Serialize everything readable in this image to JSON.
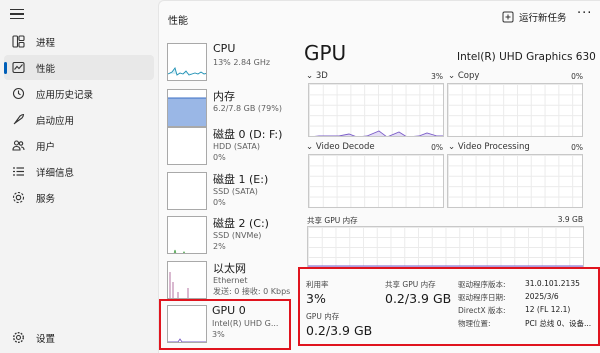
{
  "nav": {
    "items": [
      {
        "label": "进程",
        "icon": "processes-icon"
      },
      {
        "label": "性能",
        "icon": "performance-icon"
      },
      {
        "label": "应用历史记录",
        "icon": "app-history-icon"
      },
      {
        "label": "启动应用",
        "icon": "startup-apps-icon"
      },
      {
        "label": "用户",
        "icon": "users-icon"
      },
      {
        "label": "详细信息",
        "icon": "details-icon"
      },
      {
        "label": "服务",
        "icon": "services-icon"
      }
    ],
    "settings_label": "设置"
  },
  "header": {
    "title": "性能",
    "run_task_label": "运行新任务",
    "more_label": "···"
  },
  "devices": [
    {
      "name": "CPU",
      "sub1": "13%  2.84 GHz",
      "sub2": ""
    },
    {
      "name": "内存",
      "sub1": "6.2/7.8 GB (79%)",
      "sub2": ""
    },
    {
      "name": "磁盘 0 (D: F:)",
      "sub1": "HDD (SATA)",
      "sub2": "0%"
    },
    {
      "name": "磁盘 1 (E:)",
      "sub1": "SSD (SATA)",
      "sub2": "0%"
    },
    {
      "name": "磁盘 2 (C:)",
      "sub1": "SSD (NVMe)",
      "sub2": "2%"
    },
    {
      "name": "以太网",
      "sub1": "Ethernet",
      "sub2": "发送: 0 接收: 0 Kbps"
    },
    {
      "name": "GPU 0",
      "sub1": "Intel(R) UHD G...",
      "sub2": "3%"
    }
  ],
  "detail": {
    "title": "GPU",
    "model": "Intel(R) UHD Graphics 630",
    "graphs": [
      {
        "label": "3D",
        "pct": "3%"
      },
      {
        "label": "Copy",
        "pct": "0%"
      },
      {
        "label": "Video Decode",
        "pct": "0%"
      },
      {
        "label": "Video Processing",
        "pct": "0%"
      }
    ],
    "shared_mem_label": "共享 GPU 内存",
    "shared_mem_max": "3.9 GB"
  },
  "stats": {
    "util_label": "利用率",
    "util_value": "3%",
    "shared_label": "共享 GPU 内存",
    "shared_value": "0.2/3.9 GB",
    "gpu_mem_label": "GPU 内存",
    "gpu_mem_value": "0.2/3.9 GB",
    "kv": [
      {
        "key": "驱动程序版本:",
        "val": "31.0.101.2135"
      },
      {
        "key": "驱动程序日期:",
        "val": "2025/3/6"
      },
      {
        "key": "DirectX 版本:",
        "val": "12 (FL 12.1)"
      },
      {
        "key": "物理位置:",
        "val": "PCI 总线 0、设备..."
      }
    ]
  },
  "colors": {
    "accent": "#005fb8",
    "highlight_border": "#e0141e",
    "cpu_line": "#1c8fb3",
    "memory_fill": "#9ab7e6",
    "memory_line": "#3b6fc4",
    "disk_line": "#4da34d",
    "ethernet_line": "#a0508a",
    "gpu_line": "#7a5cc7"
  }
}
